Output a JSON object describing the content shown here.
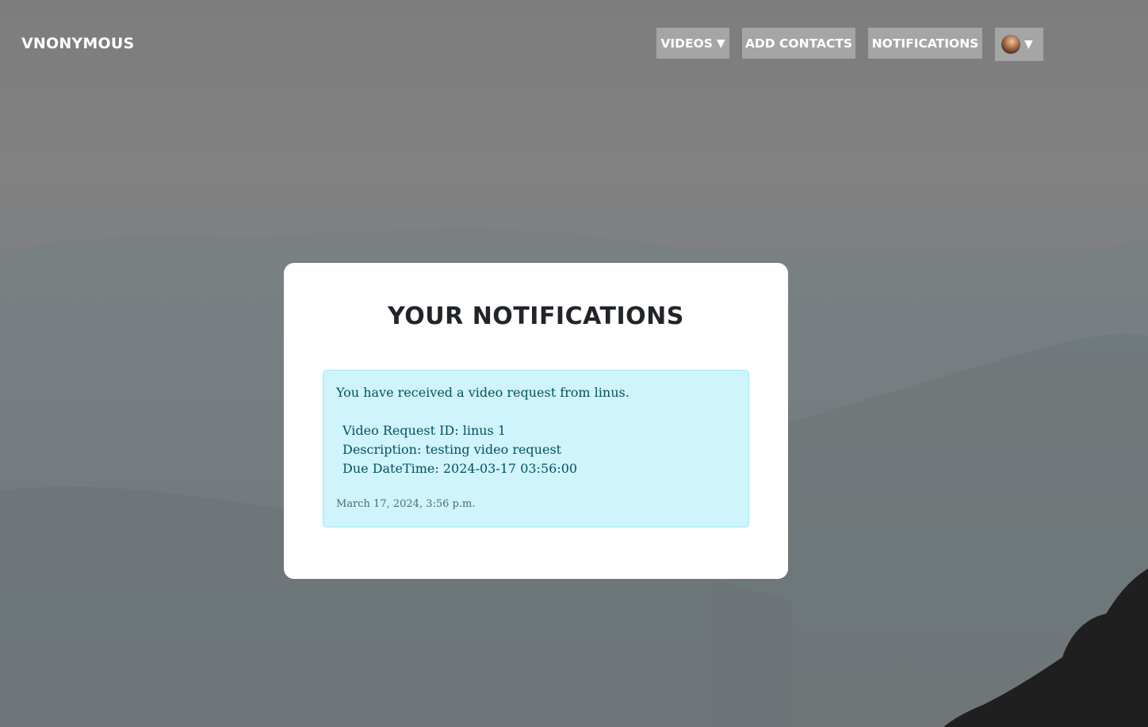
{
  "navbar": {
    "brand": "VNONYMOUS",
    "videos_label": "VIDEOS",
    "add_contacts_label": "ADD CONTACTS",
    "notifications_label": "NOTIFICATIONS",
    "caret_glyph": "▼"
  },
  "page": {
    "title": "YOUR NOTIFICATIONS"
  },
  "notifications": [
    {
      "message": "You have received a video request from linus.",
      "request_id": "Video Request ID: linus 1",
      "description": "Description: testing video request",
      "due": "Due DateTime: 2024-03-17 03:56:00",
      "timestamp": "March 17, 2024, 3:56 p.m."
    }
  ],
  "colors": {
    "nav_button_bg": "#a5a5a5",
    "alert_bg": "#cff4fc",
    "alert_border": "#9eeaf9",
    "alert_text": "#055160"
  }
}
